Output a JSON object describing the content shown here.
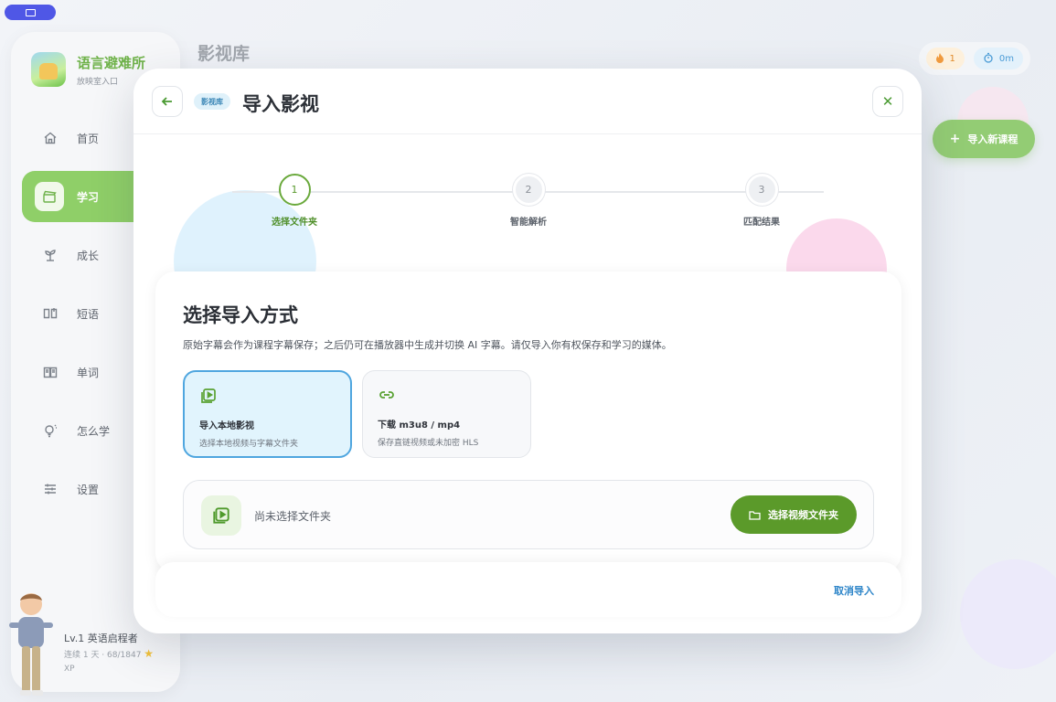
{
  "app": {
    "brand_title": "语言避难所",
    "brand_subtitle": "放映室入口",
    "page_title": "影视库"
  },
  "sidebar": {
    "items": [
      {
        "label": "首页",
        "icon": "home-icon"
      },
      {
        "label": "学习",
        "icon": "clapperboard-icon",
        "active": true
      },
      {
        "label": "成长",
        "icon": "sprout-icon"
      },
      {
        "label": "短语",
        "icon": "book-open-icon"
      },
      {
        "label": "单词",
        "icon": "book-icon"
      },
      {
        "label": "怎么学",
        "icon": "lightbulb-icon"
      },
      {
        "label": "设置",
        "icon": "sliders-icon"
      }
    ]
  },
  "profile": {
    "level": "Lv.1 英语启程者",
    "streak": "连续 1 天 · 68/1847",
    "xp_unit": "XP"
  },
  "topbar": {
    "fire_count": "1",
    "timer": "0m",
    "new_course_label": "导入新课程"
  },
  "modal": {
    "breadcrumb": "影视库",
    "title": "导入影视",
    "steps": [
      {
        "number": "1",
        "label": "选择文件夹"
      },
      {
        "number": "2",
        "label": "智能解析"
      },
      {
        "number": "3",
        "label": "匹配结果"
      }
    ],
    "card_title": "选择导入方式",
    "card_desc": "原始字幕会作为课程字幕保存；之后仍可在播放器中生成并切换 AI 字幕。请仅导入你有权保存和学习的媒体。",
    "options": [
      {
        "title": "导入本地影视",
        "subtitle": "选择本地视频与字幕文件夹",
        "icon": "video-file-icon"
      },
      {
        "title": "下载 m3u8 / mp4",
        "subtitle": "保存直链视频或未加密 HLS",
        "icon": "link-icon"
      }
    ],
    "picker_text": "尚未选择文件夹",
    "choose_button": "选择视频文件夹",
    "cancel_label": "取消导入"
  },
  "colors": {
    "brand_green": "#6fb24a",
    "primary_button": "#5b9a2a",
    "selected_border": "#4fa6df",
    "link_blue": "#2f86c9"
  }
}
